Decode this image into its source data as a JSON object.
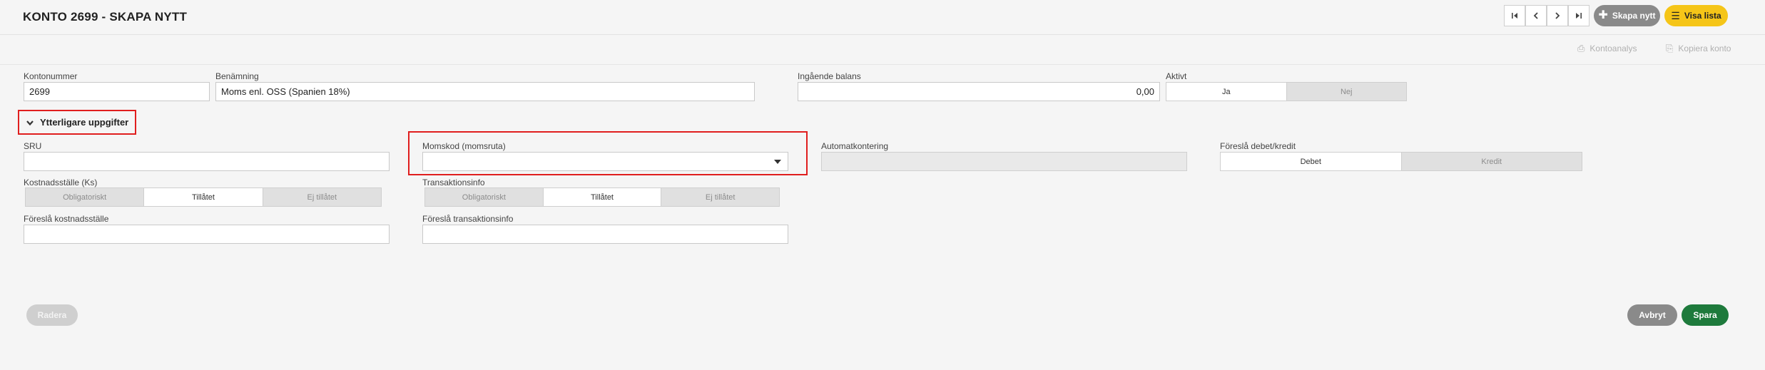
{
  "header": {
    "title": "KONTO 2699 - SKAPA NYTT",
    "create_new_label": "Skapa nytt",
    "show_list_label": "Visa lista"
  },
  "toolbar": {
    "account_analysis_label": "Kontoanalys",
    "copy_account_label": "Kopiera konto"
  },
  "form": {
    "account_number": {
      "label": "Kontonummer",
      "value": "2699"
    },
    "name": {
      "label": "Benämning",
      "value": "Moms enl. OSS (Spanien 18%)"
    },
    "opening_balance": {
      "label": "Ingående balans",
      "value": "0,00"
    },
    "active": {
      "label": "Aktivt",
      "yes": "Ja",
      "no": "Nej",
      "selected": "Ja"
    }
  },
  "extra": {
    "toggle_label": "Ytterligare uppgifter",
    "sru": {
      "label": "SRU",
      "value": ""
    },
    "vat_code": {
      "label": "Momskod (momsruta)",
      "value": ""
    },
    "auto_posting": {
      "label": "Automatkontering",
      "value": ""
    },
    "suggest_debit_credit": {
      "label": "Föreslå debet/kredit",
      "debit": "Debet",
      "credit": "Kredit",
      "selected": "Debet"
    },
    "cost_center": {
      "label": "Kostnadsställe (Ks)",
      "options": [
        "Obligatoriskt",
        "Tillåtet",
        "Ej tillåtet"
      ],
      "selected": "Tillåtet"
    },
    "transaction_info": {
      "label": "Transaktionsinfo",
      "options": [
        "Obligatoriskt",
        "Tillåtet",
        "Ej tillåtet"
      ],
      "selected": "Tillåtet"
    },
    "suggest_cost_center": {
      "label": "Föreslå kostnadsställe",
      "value": ""
    },
    "suggest_transaction_info": {
      "label": "Föreslå transaktionsinfo",
      "value": ""
    }
  },
  "footer": {
    "delete_label": "Radera",
    "cancel_label": "Avbryt",
    "save_label": "Spara"
  },
  "colors": {
    "accent_yellow": "#f5c518",
    "save_green": "#1e7a3c",
    "highlight_red": "#e01e1e",
    "neutral_grey": "#8a8a8a"
  }
}
